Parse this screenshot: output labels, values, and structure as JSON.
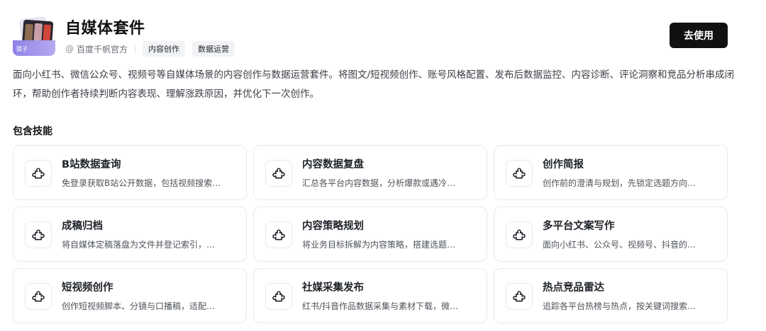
{
  "header": {
    "app_icon_label": "猜子",
    "title": "自媒体套件",
    "publisher": "百度千帆官方",
    "tags": [
      "内容创作",
      "数据运营"
    ],
    "use_button_label": "去使用"
  },
  "description": "面向小红书、微信公众号、视频号等自媒体场景的内容创作与数据运营套件。将图文/短视频创作、账号风格配置、发布后数据监控、内容诊断、评论洞察和竞品分析串成闭环，帮助创作者持续判断内容表现、理解涨跌原因，并优化下一次创作。",
  "skills_section": {
    "title": "包含技能",
    "icon": "puzzle-piece-icon",
    "items": [
      {
        "name": "B站数据查询",
        "desc": "免登录获取B站公开数据，包括视频搜索…"
      },
      {
        "name": "内容数据复盘",
        "desc": "汇总各平台内容数据，分析爆款或遇冷…"
      },
      {
        "name": "创作简报",
        "desc": "创作前的澄清与规划，先锁定选题方向…"
      },
      {
        "name": "成稿归档",
        "desc": "将自媒体定稿落盘为文件并登记索引，…"
      },
      {
        "name": "内容策略规划",
        "desc": "将业务目标拆解为内容策略，搭建选题…"
      },
      {
        "name": "多平台文案写作",
        "desc": "面向小红书、公众号、视频号、抖音的…"
      },
      {
        "name": "短视频创作",
        "desc": "创作短视频脚本、分镜与口播稿，适配…"
      },
      {
        "name": "社媒采集发布",
        "desc": "红书/抖音作品数据采集与素材下载，微…"
      },
      {
        "name": "热点竞品雷达",
        "desc": "追踪各平台热榜与热点，按关键词搜索…"
      }
    ]
  },
  "colors": {
    "primary_button": "#111111",
    "tag_background": "#f2f3f5",
    "card_border": "#e8e9eb",
    "icon_base": "#9d90ec"
  }
}
